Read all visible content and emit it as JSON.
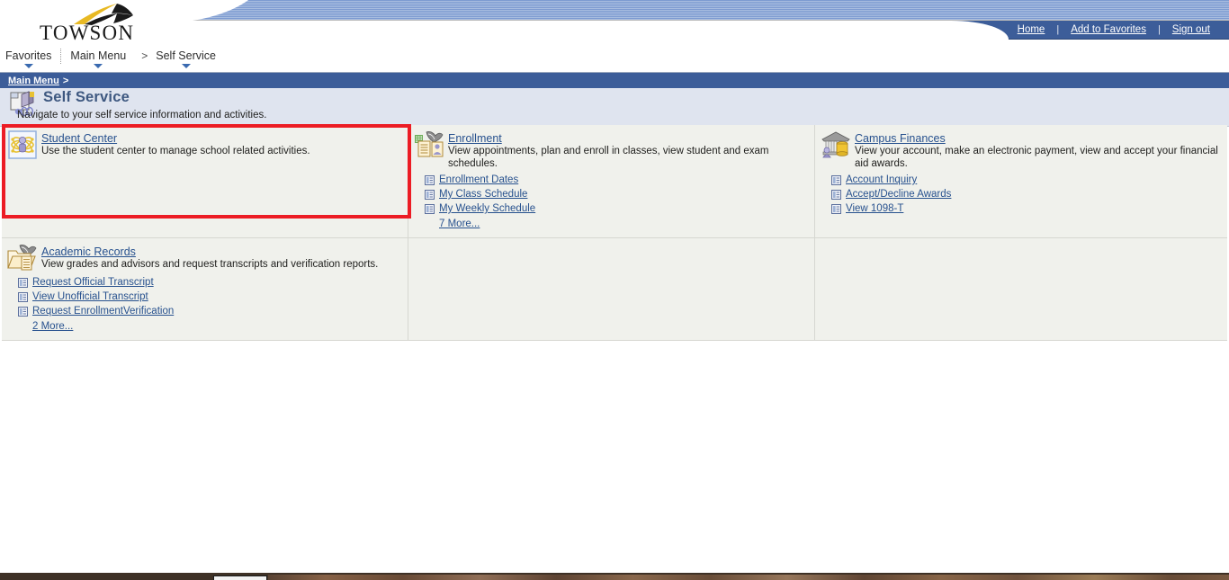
{
  "brand": {
    "logo_text": "TOWSON",
    "logo_icon": "towson-swoosh-logo"
  },
  "topnav": {
    "items": [
      {
        "label": "Home",
        "name": "home-link"
      },
      {
        "label": "Add to Favorites",
        "name": "add-to-favorites-link"
      },
      {
        "label": "Sign out",
        "name": "sign-out-link"
      }
    ],
    "separator": "|"
  },
  "menubar": {
    "favorites": "Favorites",
    "main_menu": "Main Menu",
    "separator_gt": ">",
    "self_service": "Self Service"
  },
  "breadcrumb": {
    "root": "Main Menu",
    "gt": ">"
  },
  "pagehead": {
    "title": "Self Service",
    "subtitle": "Navigate to your self service information and activities.",
    "icon": "self-service-folder-icon"
  },
  "folders": [
    {
      "id": "student-center",
      "title": "Student Center",
      "description": "Use the student center to manage school related activities.",
      "icon": "student-center-atom-icon",
      "links": [],
      "more": null,
      "highlighted": true
    },
    {
      "id": "enrollment",
      "title": "Enrollment",
      "description": "View appointments, plan and enroll in classes, view student and exam schedules.",
      "icon": "enrollment-folder-icon",
      "links": [
        {
          "label": "Enrollment Dates",
          "icon": "page-list-icon"
        },
        {
          "label": "My Class Schedule",
          "icon": "page-list-icon"
        },
        {
          "label": "My Weekly Schedule",
          "icon": "page-list-icon"
        }
      ],
      "more": "7 More...",
      "highlighted": false
    },
    {
      "id": "campus-finances",
      "title": "Campus Finances",
      "description": "View your account, make an electronic payment, view and accept your financial aid awards.",
      "icon": "campus-finances-bank-icon",
      "links": [
        {
          "label": "Account Inquiry",
          "icon": "page-list-icon"
        },
        {
          "label": "Accept/Decline Awards",
          "icon": "page-list-icon"
        },
        {
          "label": "View 1098-T",
          "icon": "page-list-icon"
        }
      ],
      "more": null,
      "highlighted": false
    },
    {
      "id": "academic-records",
      "title": "Academic Records",
      "description": "View grades and advisors and request transcripts and verification reports.",
      "icon": "academic-records-folder-icon",
      "links": [
        {
          "label": "Request Official Transcript",
          "icon": "page-list-icon"
        },
        {
          "label": "View Unofficial Transcript",
          "icon": "page-list-icon"
        },
        {
          "label": "Request EnrollmentVerification",
          "icon": "page-list-icon"
        }
      ],
      "more": "2 More...",
      "highlighted": false
    }
  ],
  "colors": {
    "header_blue": "#3c5d99",
    "link_blue": "#27518e",
    "panel_bg": "#f0f1ec",
    "pagehead_bg": "#dfe4ef",
    "highlight_red": "#ec1c24",
    "logo_gold": "#e6b422"
  }
}
